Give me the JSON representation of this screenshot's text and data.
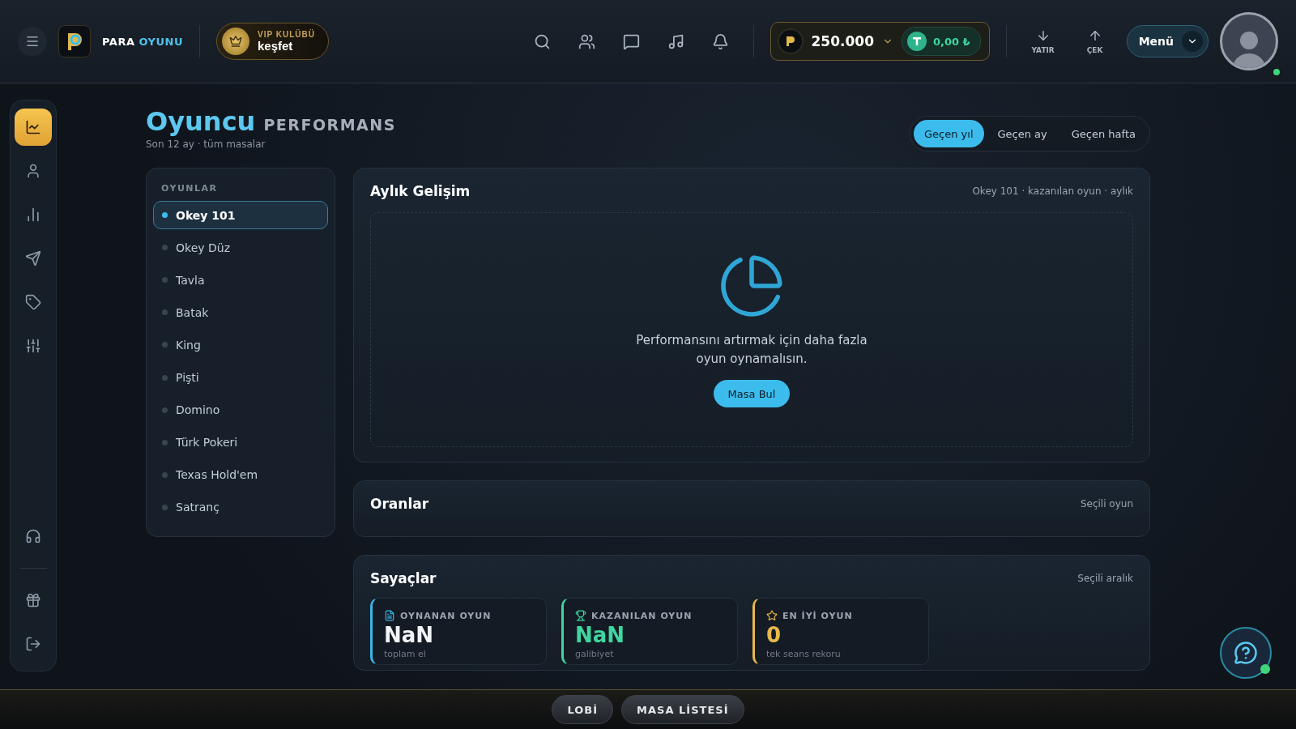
{
  "header": {
    "brand": {
      "word_1": "PARA",
      "word_2": "OYUNU"
    },
    "vip": {
      "label": "VIP KULÜBÜ",
      "action": "keşfet"
    },
    "balance": {
      "coins": "250.000",
      "crypto": "0,00 ₺"
    },
    "deposit": "YATIR",
    "withdraw": "ÇEK",
    "menu": "Menü",
    "online": true
  },
  "sidebar": {
    "items": [
      {
        "kind": "chart",
        "selected": true
      },
      {
        "kind": "user",
        "selected": false
      },
      {
        "kind": "bars",
        "selected": false
      },
      {
        "kind": "send",
        "selected": false
      },
      {
        "kind": "tag",
        "selected": false
      },
      {
        "kind": "sliders",
        "selected": false
      }
    ],
    "bottom_items": [
      {
        "kind": "headset"
      },
      {
        "kind": "gift"
      },
      {
        "kind": "logout"
      }
    ]
  },
  "page": {
    "title": "Oyuncu",
    "title_suffix": "PERFORMANS",
    "subtitle": "Son 12 ay · tüm masalar",
    "ranges": [
      {
        "label": "Geçen yıl",
        "selected": true
      },
      {
        "label": "Geçen ay",
        "selected": false
      },
      {
        "label": "Geçen hafta",
        "selected": false
      }
    ]
  },
  "games": {
    "heading": "OYUNLAR",
    "items": [
      {
        "label": "Okey 101",
        "selected": true
      },
      {
        "label": "Okey Düz",
        "selected": false
      },
      {
        "label": "Tavla",
        "selected": false
      },
      {
        "label": "Batak",
        "selected": false
      },
      {
        "label": "King",
        "selected": false
      },
      {
        "label": "Pişti",
        "selected": false
      },
      {
        "label": "Domino",
        "selected": false
      },
      {
        "label": "Türk Pokeri",
        "selected": false
      },
      {
        "label": "Texas Hold'em",
        "selected": false
      },
      {
        "label": "Satranç",
        "selected": false
      }
    ]
  },
  "monthly": {
    "title": "Aylık Gelişim",
    "meta": "Okey 101 · kazanılan oyun · aylık",
    "empty_text": "Performansını artırmak için daha fazla oyun oynamalısın.",
    "button": "Masa Bul"
  },
  "ratios": {
    "title": "Oranlar",
    "meta": "Seçili oyun"
  },
  "counters": {
    "title": "Sayaçlar",
    "meta": "Seçili aralık",
    "cards": [
      {
        "kind": "doc",
        "label": "OYNANAN OYUN",
        "value": "NaN",
        "note": "toplam el",
        "color": "#38b6e8"
      },
      {
        "kind": "trophy",
        "label": "KAZANILAN OYUN",
        "value": "NaN",
        "note": "galibiyet",
        "color": "#3fd6a0"
      },
      {
        "kind": "star",
        "label": "EN İYİ OYUN",
        "value": "0",
        "note": "tek seans rekoru",
        "color": "#e8b94a"
      }
    ]
  },
  "bottom_bar": {
    "buttons": [
      "LOBİ",
      "MASA LİSTESİ"
    ]
  },
  "support": {
    "online": true
  }
}
